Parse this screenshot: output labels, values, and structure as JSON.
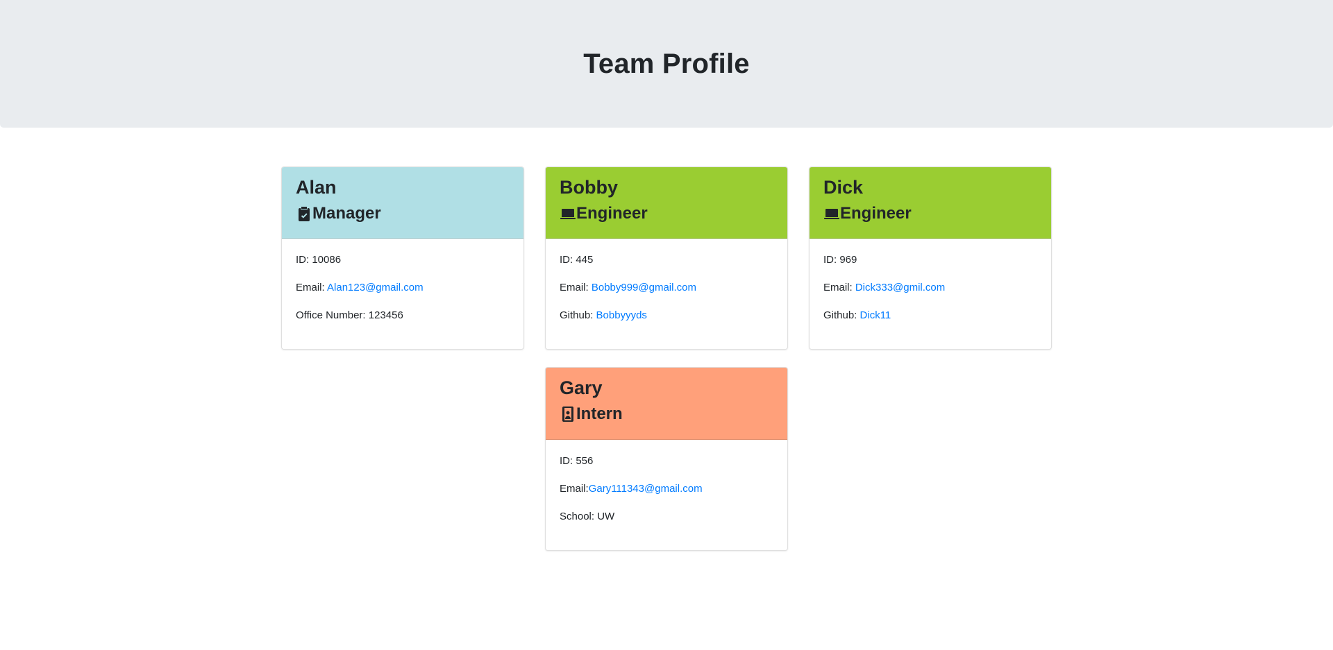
{
  "header": {
    "title": "Team Profile"
  },
  "colors": {
    "manager": "#b0dfe5",
    "engineer": "#9acd32",
    "intern": "#ffa07a",
    "link": "#007bff"
  },
  "cards": [
    {
      "name": "Alan",
      "role": "Manager",
      "role_icon": "clipboard-check-icon",
      "id_line": "ID: 10086",
      "email_label": "Email: ",
      "email": "Alan123@gmail.com",
      "extra_label": "Office Number: 123456",
      "extra_link": ""
    },
    {
      "name": "Bobby",
      "role": "Engineer",
      "role_icon": "laptop-icon",
      "id_line": "ID: 445",
      "email_label": "Email: ",
      "email": "Bobby999@gmail.com",
      "extra_label": "Github: ",
      "extra_link": "Bobbyyyds"
    },
    {
      "name": "Dick",
      "role": "Engineer",
      "role_icon": "laptop-icon",
      "id_line": "ID: 969",
      "email_label": "Email: ",
      "email": "Dick333@gmil.com",
      "extra_label": "Github: ",
      "extra_link": "Dick11"
    },
    {
      "name": "Gary",
      "role": "Intern",
      "role_icon": "id-badge-icon",
      "id_line": "ID: 556",
      "email_label": "Email:",
      "email": "Gary111343@gmail.com",
      "extra_label": "School: UW",
      "extra_link": ""
    }
  ]
}
